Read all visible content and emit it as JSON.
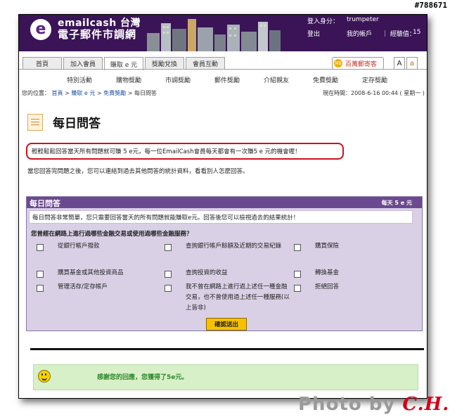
{
  "watermark_id": "#788671",
  "header": {
    "brand_top": "emailcash 台灣",
    "brand_bottom": "電子郵件市調網",
    "login_label": "登入身分：",
    "username": "trumpeter",
    "logout_label": "登出",
    "account_label": "我的帳戶",
    "exp_label": "｜ 經驗值：",
    "exp_value": "15"
  },
  "nav": {
    "tabs": [
      {
        "label": "首頁",
        "active": false
      },
      {
        "label": "加入會員",
        "active": false
      },
      {
        "label": "賺取 e 元",
        "active": true
      },
      {
        "label": "獎勵兌換",
        "active": false
      },
      {
        "label": "會員互動",
        "active": false
      }
    ],
    "subnav": [
      "特別活動",
      "購物獎勵",
      "市調獎勵",
      "郵件獎勵",
      "介紹親友",
      "免費獎勵",
      "定存獎勵"
    ],
    "mail_button": "百萬郵寄客",
    "mail_badge": "MB",
    "font_large": "A",
    "font_small": "a"
  },
  "breadcrumb": {
    "label": "您的位置：",
    "items": [
      "首頁",
      "賺取 e 元",
      "免費獎勵"
    ],
    "current": "每日問答",
    "now_label": "現在時間：",
    "now_value": "2008-6-16 00:44 ( 星期一 )"
  },
  "page": {
    "title": "每日問答",
    "highlight": "輕輕鬆鬆回答當天所有問題就可賺 5 e元，每一位EmailCash會員每天都會有一次賺5 e 元的機會喔！",
    "after_text": "當您回答完問題之後，您可以連結到過去其他問答的統計資料，看看別人怎麼回答。"
  },
  "panel": {
    "title": "每日問答",
    "reward": "每天 5 e 元",
    "intro": "每日問答非常簡單，您只需要回答當天的所有問題就能賺取e元。回答後您可以檢視過去的結果統計！",
    "question": "您曾經在網路上進行過哪些金融交易或使用過哪些金融服務？",
    "options": [
      "從銀行帳戶撥款",
      "查詢銀行帳戶餘額及近期的交易紀錄",
      "購買保險",
      "購買基金或其他投資商品",
      "查詢投資的收益",
      "轉換基金",
      "管理活存/定存帳戶",
      "我不曾在網路上進行過上述任一種金融交易，也不曾使用過上述任一種服務(以上皆非)",
      "拒絕回答"
    ],
    "submit": "確認送出"
  },
  "thanks": "感謝您的回應，您獲得了5e元。",
  "photo_credit": {
    "prefix": "Photo by",
    "name": "C.H."
  }
}
